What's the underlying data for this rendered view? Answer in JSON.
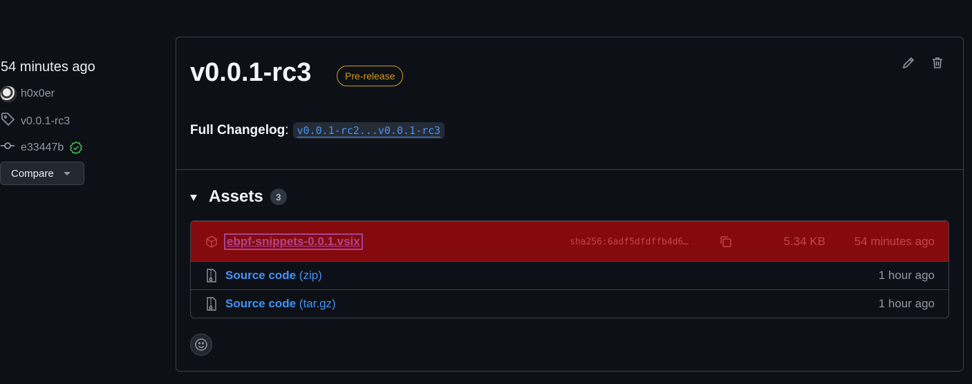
{
  "sidebar": {
    "relative_time": "54 minutes ago",
    "author": "h0x0er",
    "tag": "v0.0.1-rc3",
    "commit": "e33447b",
    "compare_label": "Compare"
  },
  "release": {
    "title": "v0.0.1-rc3",
    "badge": "Pre-release",
    "changelog_label": "Full Changelog",
    "changelog_colon": ":",
    "changelog_link": "v0.0.1-rc2...v0.0.1-rc3"
  },
  "assets": {
    "title": "Assets",
    "count": "3",
    "items": [
      {
        "name": "ebpf-snippets-0.0.1.vsix",
        "sha": "sha256:6adf5dfdffb4d6…",
        "size": "5.34 KB",
        "time": "54 minutes ago",
        "icon": "package-icon"
      },
      {
        "name": "Source code",
        "ext": "(zip)",
        "time": "1 hour ago",
        "icon": "file-zip-icon"
      },
      {
        "name": "Source code",
        "ext": "(tar.gz)",
        "time": "1 hour ago",
        "icon": "file-zip-icon"
      }
    ]
  },
  "colors": {
    "background": "#0d1117",
    "border": "#3d444d",
    "link": "#4493f8",
    "prerelease": "#d29922",
    "highlight_row": "#850a0d",
    "verified": "#3fb950"
  }
}
